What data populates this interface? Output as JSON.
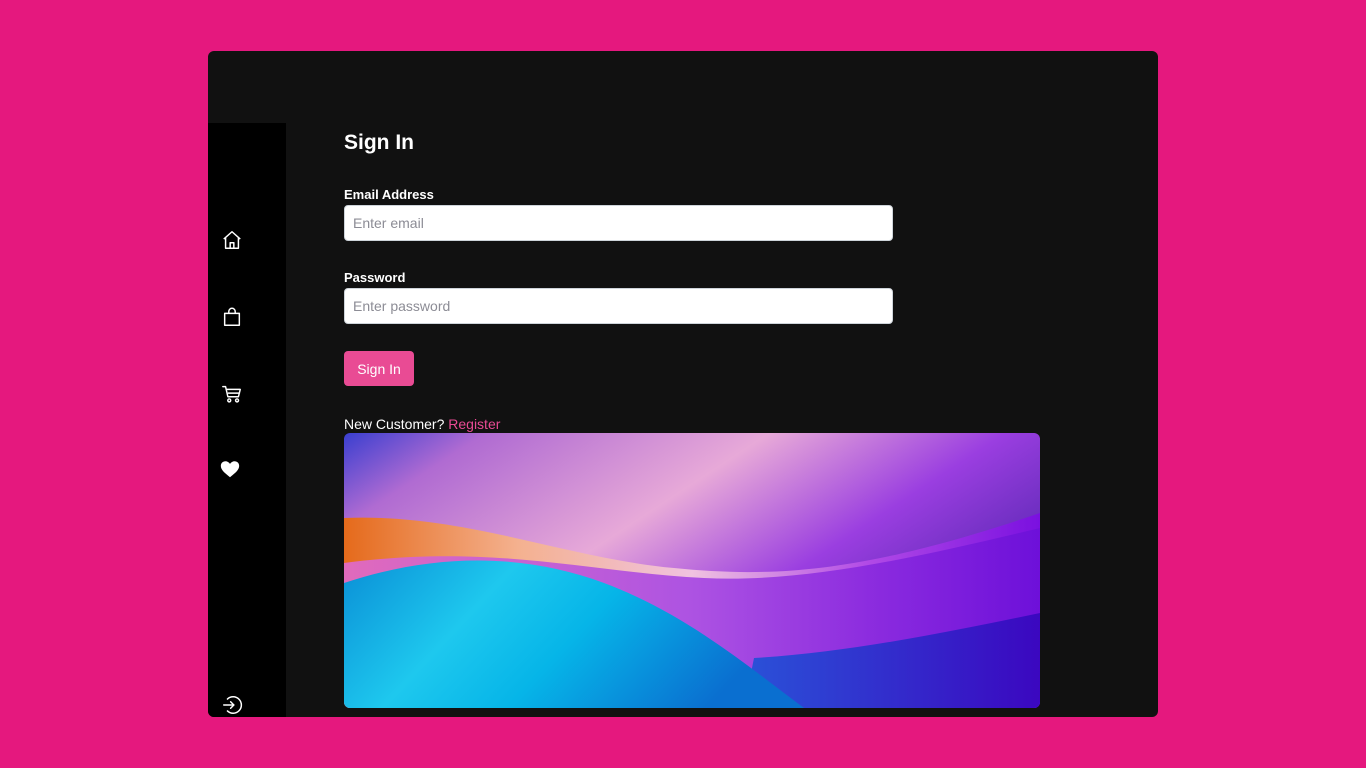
{
  "page": {
    "background_color": "#e5187e",
    "window_color": "#111111",
    "sidebar_color": "#000000",
    "accent_color": "#e94b94"
  },
  "sidebar": {
    "items": [
      {
        "icon": "home-icon"
      },
      {
        "icon": "shopping-bag-icon"
      },
      {
        "icon": "cart-icon"
      },
      {
        "icon": "heart-icon"
      }
    ],
    "bottom_items": [
      {
        "icon": "sign-in-icon"
      },
      {
        "icon": "add-user-icon"
      }
    ]
  },
  "form": {
    "title": "Sign In",
    "email_label": "Email Address",
    "email_placeholder": "Enter email",
    "email_value": "",
    "password_label": "Password",
    "password_placeholder": "Enter password",
    "password_value": "",
    "submit_label": "Sign In",
    "new_customer_text": "New Customer?",
    "register_label": "Register"
  },
  "hero_image": {
    "description_icon": "abstract-wave-image"
  }
}
